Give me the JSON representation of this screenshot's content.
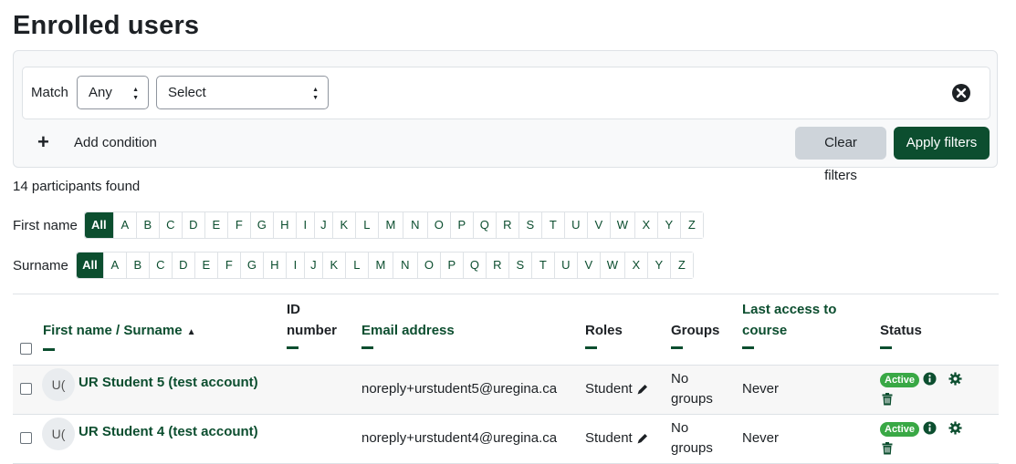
{
  "page": {
    "title": "Enrolled users"
  },
  "filters": {
    "match_label": "Match",
    "match_value": "Any",
    "type_value": "Select",
    "add_condition": "Add condition",
    "clear_label": "Clear filters",
    "apply_label": "Apply filters"
  },
  "participants_count": "14 participants found",
  "initials": {
    "first_label": "First name",
    "surname_label": "Surname",
    "all": "All",
    "letters": [
      "A",
      "B",
      "C",
      "D",
      "E",
      "F",
      "G",
      "H",
      "I",
      "J",
      "K",
      "L",
      "M",
      "N",
      "O",
      "P",
      "Q",
      "R",
      "S",
      "T",
      "U",
      "V",
      "W",
      "X",
      "Y",
      "Z"
    ]
  },
  "table": {
    "headers": {
      "name": "First name / Surname",
      "id_line1": "ID",
      "id_line2": "number",
      "email": "Email address",
      "roles": "Roles",
      "groups": "Groups",
      "access_line1": "Last access to",
      "access_line2": "course",
      "status": "Status"
    },
    "rows": [
      {
        "initials": "U(",
        "name": "UR Student 5 (test account)",
        "email": "noreply+urstudent5@uregina.ca",
        "role": "Student",
        "groups_line1": "No",
        "groups_line2": "groups",
        "last_access": "Never",
        "status": "Active"
      },
      {
        "initials": "U(",
        "name": "UR Student 4 (test account)",
        "email": "noreply+urstudent4@uregina.ca",
        "role": "Student",
        "groups_line1": "No",
        "groups_line2": "groups",
        "last_access": "Never",
        "status": "Active"
      }
    ]
  },
  "colors": {
    "brand": "#0c4e2f",
    "active_badge": "#39a845",
    "panel_bg": "#f8f9fa"
  }
}
